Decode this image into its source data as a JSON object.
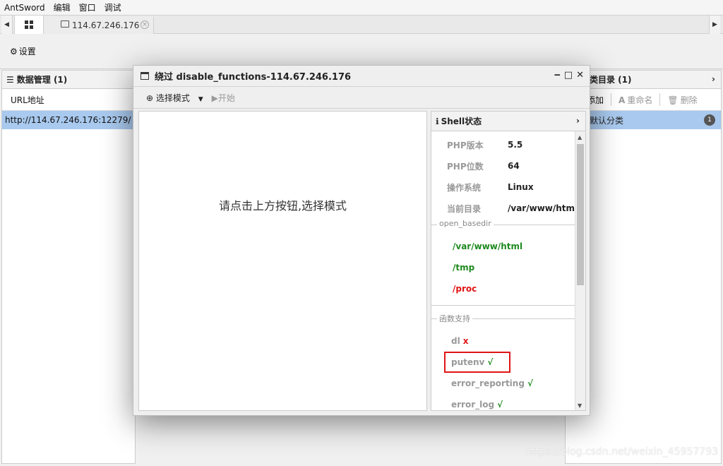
{
  "menubar": [
    "AntSword",
    "编辑",
    "窗口",
    "调试"
  ],
  "tabs": {
    "shell_tab_label": "114.67.246.176"
  },
  "toolbar": {
    "settings_label": "设置"
  },
  "left_panel": {
    "title": "数据管理 (1)",
    "column_header": "URL地址",
    "rows": [
      "http://114.67.246.176:12279/"
    ]
  },
  "right_panel": {
    "title": "类目录 (1)",
    "tools": {
      "add": "添加",
      "rename": "重命名",
      "delete": "删除"
    },
    "rows": [
      {
        "label": "默认分类",
        "count": "1"
      }
    ]
  },
  "modal": {
    "title": "绕过 disable_functions-114.67.246.176",
    "mode_button": "选择模式",
    "start_button": "开始",
    "hint": "请点击上方按钮,选择模式",
    "shell_panel": {
      "title": "Shell状态",
      "info": [
        {
          "key": "PHP版本",
          "value": "5.5"
        },
        {
          "key": "PHP位数",
          "value": "64"
        },
        {
          "key": "操作系统",
          "value": "Linux"
        },
        {
          "key": "当前目录",
          "value": "/var/www/htm"
        }
      ],
      "basedir_label": "open_basedir",
      "basedir": [
        {
          "path": "/var/www/html",
          "color": "#1f8a1f"
        },
        {
          "path": "/tmp",
          "color": "#1f8a1f"
        },
        {
          "path": "/proc",
          "color": "#e01515"
        }
      ],
      "func_label": "函数支持",
      "functions": [
        {
          "name": "dl",
          "mark": "x",
          "color": "#e01515"
        },
        {
          "name": "putenv",
          "mark": "√",
          "color": "#1f8a1f"
        },
        {
          "name": "error_reporting",
          "mark": "√",
          "color": "#1f8a1f"
        },
        {
          "name": "error_log",
          "mark": "√",
          "color": "#1f8a1f"
        }
      ]
    }
  },
  "watermark": "https://blog.csdn.net/weixin_45957793"
}
